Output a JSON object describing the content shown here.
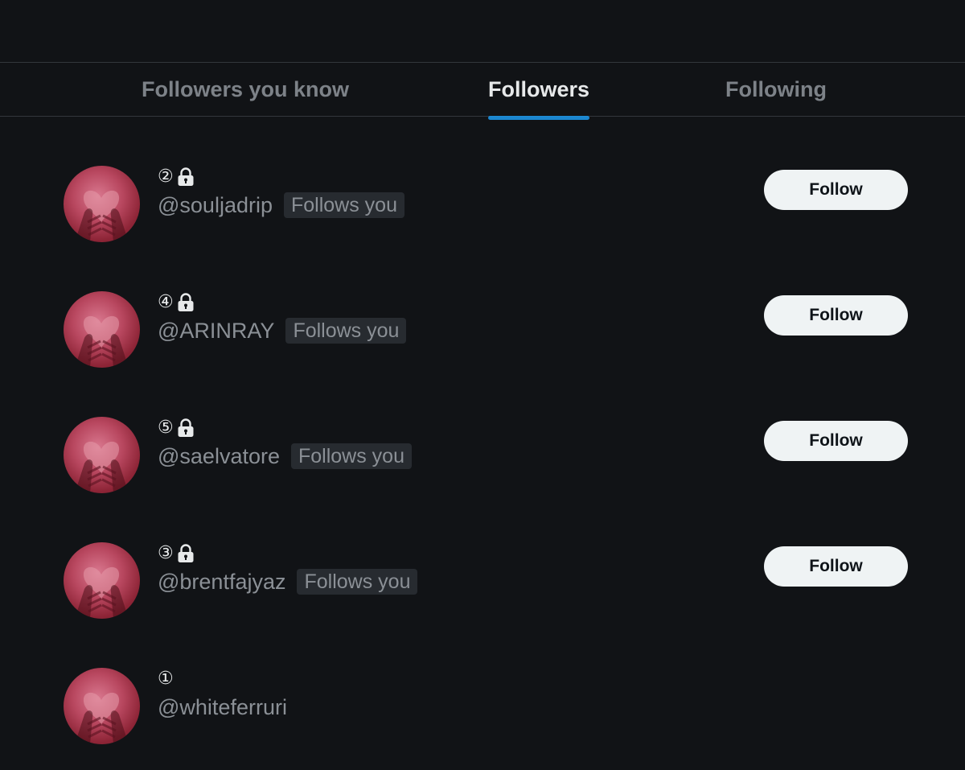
{
  "tabs": [
    {
      "label": "Followers you know",
      "active": false
    },
    {
      "label": "Followers",
      "active": true
    },
    {
      "label": "Following",
      "active": false
    }
  ],
  "users": [
    {
      "number": "②",
      "locked": true,
      "handle": "@souljadrip",
      "follows_you": "Follows you",
      "follow_label": "Follow"
    },
    {
      "number": "④",
      "locked": true,
      "handle": "@ARINRAY",
      "follows_you": "Follows you",
      "follow_label": "Follow"
    },
    {
      "number": "⑤",
      "locked": true,
      "handle": "@saelvatore",
      "follows_you": "Follows you",
      "follow_label": "Follow"
    },
    {
      "number": "③",
      "locked": true,
      "handle": "@brentfajyaz",
      "follows_you": "Follows you",
      "follow_label": "Follow"
    },
    {
      "number": "①",
      "locked": false,
      "handle": "@whiteferruri",
      "follows_you": null,
      "follow_label": null
    }
  ],
  "colors": {
    "background": "#111316",
    "accent": "#1d9bf0",
    "button_bg": "#eff3f4",
    "muted_text": "#8b9096"
  },
  "icons": {
    "lock": "lock-icon",
    "avatar": "heart-hands-avatar"
  }
}
